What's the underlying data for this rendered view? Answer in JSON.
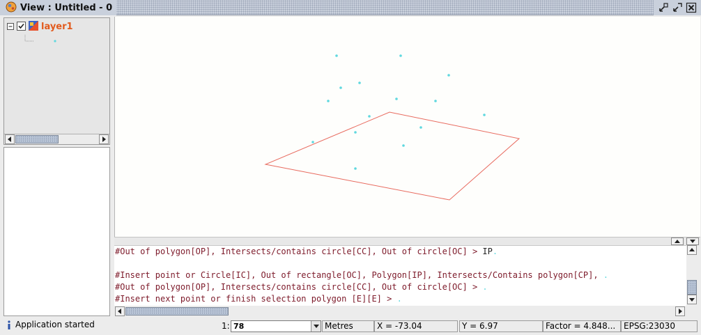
{
  "window": {
    "title": "View : Untitled - 0"
  },
  "toc": {
    "layer": {
      "name": "layer1",
      "checked": true
    },
    "point_symbol_color": "#5fd8df"
  },
  "map": {
    "point_color": "#5fd8df",
    "polygon_color": "#e86a5e"
  },
  "console": {
    "lines": [
      {
        "text": "#Out of polygon[OP], Intersects/contains circle[CC], Out of circle[OC] > ",
        "input": "IP"
      },
      {
        "text": "",
        "input": ""
      },
      {
        "text": "#Insert point or Circle[IC], Out of rectangle[OC], Polygon[IP], Intersects/Contains polygon[CP], ",
        "input": ""
      },
      {
        "text": "#Out of polygon[OP], Intersects/contains circle[CC], Out of circle[OC] > ",
        "input": ""
      },
      {
        "text": "#Insert next point or finish selection polygon [E][E] > ",
        "input": ""
      }
    ]
  },
  "statusbar": {
    "message": "Application started",
    "scale_prefix": "1:",
    "scale_value": "78",
    "units": "Metres",
    "x": "X = -73.04",
    "y": "Y = 6.97",
    "factor": "Factor = 4.848...",
    "epsg": "EPSG:23030"
  }
}
